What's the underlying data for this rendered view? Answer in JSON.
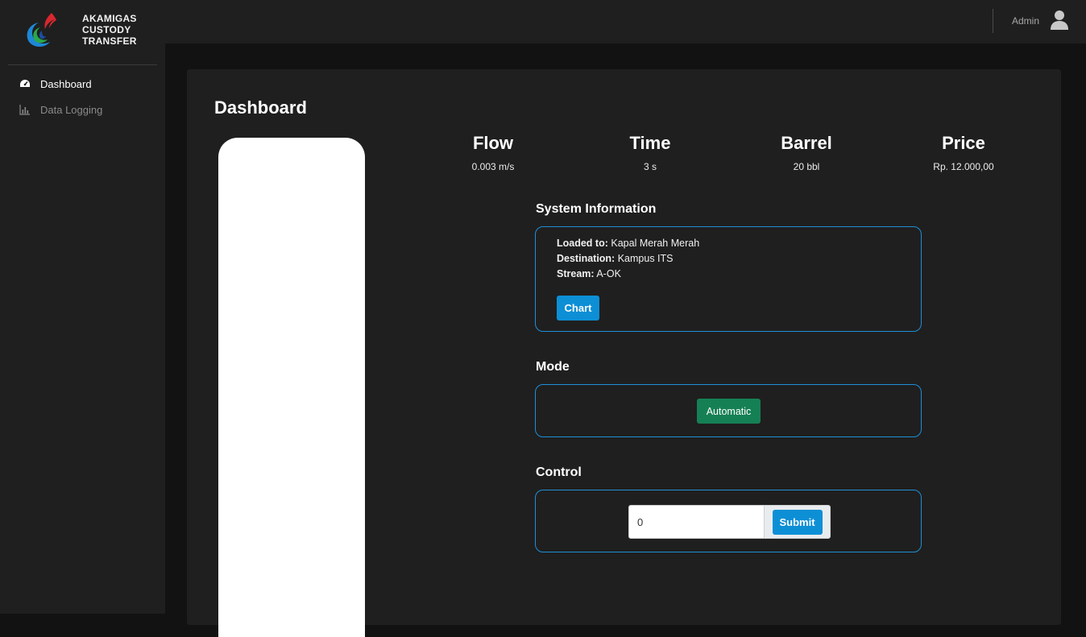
{
  "brand": {
    "lines": [
      "AKAMIGAS",
      "CUSTODY",
      "TRANSFER"
    ]
  },
  "sidebar": {
    "items": [
      {
        "label": "Dashboard",
        "icon": "tachometer-icon",
        "active": true
      },
      {
        "label": "Data Logging",
        "icon": "bar-chart-icon",
        "active": false
      }
    ]
  },
  "topbar": {
    "user_label": "Admin",
    "user_icon": "user-avatar-icon"
  },
  "main": {
    "title": "Dashboard",
    "stats": [
      {
        "label": "Flow",
        "value": "0.003 m/s"
      },
      {
        "label": "Time",
        "value": "3 s"
      },
      {
        "label": "Barrel",
        "value": "20 bbl"
      },
      {
        "label": "Price",
        "value": "Rp. 12.000,00"
      }
    ],
    "system_info": {
      "title": "System Information",
      "loaded_to_label": "Loaded to:",
      "loaded_to_value": "Kapal Merah Merah",
      "destination_label": "Destination:",
      "destination_value": "Kampus ITS",
      "stream_label": "Stream:",
      "stream_value": "A-OK",
      "chart_button": "Chart"
    },
    "mode": {
      "title": "Mode",
      "button": "Automatic"
    },
    "control": {
      "title": "Control",
      "input_value": "0",
      "submit_button": "Submit"
    }
  },
  "colors": {
    "page_bg": "#121212",
    "panel_bg": "#1f1f1f",
    "accent_blue": "#0d8fd6",
    "panel_border": "#1f8fd6",
    "mode_green": "#168055"
  }
}
